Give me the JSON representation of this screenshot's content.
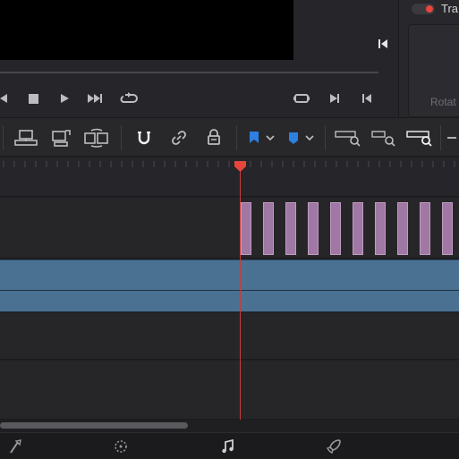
{
  "inspector": {
    "title": "Tra",
    "property_label": "Rotat",
    "toggle_state": "on"
  },
  "colors": {
    "background": "#1f1f22",
    "panel": "#28282b",
    "video_clip": "#4b7192",
    "audio_clip": "#9f78a3",
    "playhead": "#e8463c",
    "blue_flag": "#2d7fe0",
    "blue_marker": "#2d7fe0"
  },
  "transport": {
    "buttons": [
      "stop",
      "play",
      "next-clip",
      "loop",
      "match-frame",
      "next-edit",
      "go-to-end"
    ]
  },
  "toolbar": {
    "tools": [
      "overwrite-clip",
      "replace-clip",
      "swap-clip",
      "snapping",
      "linked-selection",
      "position-lock",
      "flag",
      "marker",
      "zoom-full",
      "zoom-detail",
      "zoom-custom"
    ]
  },
  "timeline": {
    "audio_clip_count": 10
  },
  "pages": [
    "color",
    "fusion",
    "fairlight",
    "deliver"
  ]
}
